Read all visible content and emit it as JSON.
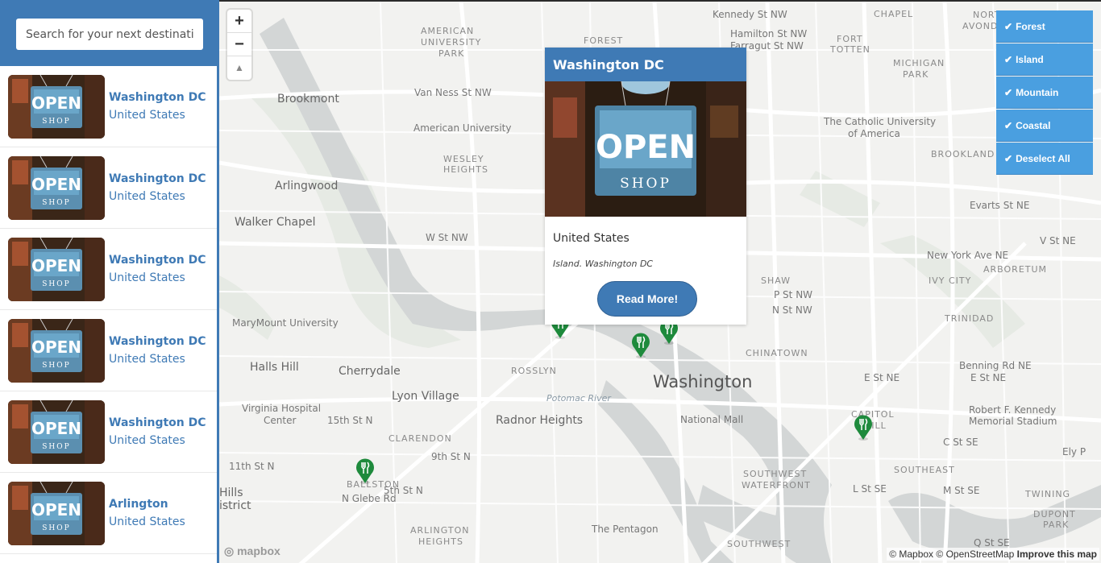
{
  "search": {
    "placeholder": "Search for your next destination!"
  },
  "listings": [
    {
      "title": "Washington DC",
      "subtitle": "United States"
    },
    {
      "title": "Washington DC",
      "subtitle": "United States"
    },
    {
      "title": "Washington DC",
      "subtitle": "United States"
    },
    {
      "title": "Washington DC",
      "subtitle": "United States"
    },
    {
      "title": "Washington DC",
      "subtitle": "United States"
    },
    {
      "title": "Arlington",
      "subtitle": "United States"
    }
  ],
  "thumbnail": {
    "sign_text": "OPEN",
    "sign_sub": "SHOP"
  },
  "zoom": {
    "in": "+",
    "out": "−",
    "compass": "▲"
  },
  "filters": [
    {
      "label": "Forest"
    },
    {
      "label": "Island"
    },
    {
      "label": "Mountain"
    },
    {
      "label": "Coastal"
    },
    {
      "label": "Deselect All"
    }
  ],
  "filter_check": "✔",
  "popup": {
    "title": "Washington DC",
    "country": "United States",
    "meta": "Island. Washington DC",
    "button": "Read More!"
  },
  "map_labels": [
    {
      "text": "Brookmont"
    },
    {
      "text": "AMERICAN"
    },
    {
      "text": "UNIVERSITY"
    },
    {
      "text": "PARK"
    },
    {
      "text": "FOREST"
    },
    {
      "text": "Kennedy St NW"
    },
    {
      "text": "Hamilton St NW"
    },
    {
      "text": "Farragut St NW"
    },
    {
      "text": "FORT"
    },
    {
      "text": "TOTTEN"
    },
    {
      "text": "MICHIGAN"
    },
    {
      "text": "PARK"
    },
    {
      "text": "NORTH"
    },
    {
      "text": "AVONDALE"
    },
    {
      "text": "CHAPEL"
    },
    {
      "text": "Van Ness St NW"
    },
    {
      "text": "American University"
    },
    {
      "text": "WESLEY"
    },
    {
      "text": "HEIGHTS"
    },
    {
      "text": "Arlingwood"
    },
    {
      "text": "Walker Chapel"
    },
    {
      "text": "The Catholic University"
    },
    {
      "text": "of America"
    },
    {
      "text": "BROOKLAND"
    },
    {
      "text": "Evarts St NE"
    },
    {
      "text": "MaryMount University"
    },
    {
      "text": "Halls Hill"
    },
    {
      "text": "Cherrydale"
    },
    {
      "text": "Lyon Village"
    },
    {
      "text": "Potomac River"
    },
    {
      "text": "ROSSLYN"
    },
    {
      "text": "Washington"
    },
    {
      "text": "CHINATOWN"
    },
    {
      "text": "National Mall"
    },
    {
      "text": "Radnor Heights"
    },
    {
      "text": "CLARENDON"
    },
    {
      "text": "Virginia Hospital"
    },
    {
      "text": "Center"
    },
    {
      "text": "BALLSTON"
    },
    {
      "text": "ARLINGTON"
    },
    {
      "text": "HEIGHTS"
    },
    {
      "text": "The Pentagon"
    },
    {
      "text": "SOUTHWEST"
    },
    {
      "text": "WATERFRONT"
    },
    {
      "text": "CAPITOL"
    },
    {
      "text": "HILL"
    },
    {
      "text": "Robert F. Kennedy"
    },
    {
      "text": "Memorial Stadium"
    },
    {
      "text": "SOUTHEAST"
    },
    {
      "text": "TWINING"
    },
    {
      "text": "DUPONT"
    },
    {
      "text": "PARK"
    },
    {
      "text": "TRINIDAD"
    },
    {
      "text": "ARBORETUM"
    },
    {
      "text": "IVY CITY"
    },
    {
      "text": "SHAW"
    },
    {
      "text": "New York Ave NE"
    },
    {
      "text": "Benning Rd NE"
    },
    {
      "text": "E St NE"
    },
    {
      "text": "E St NE"
    },
    {
      "text": "C St SE"
    },
    {
      "text": "M St SE"
    },
    {
      "text": "L St SE"
    },
    {
      "text": "V St NE"
    },
    {
      "text": "P St NW"
    },
    {
      "text": "N St NW"
    },
    {
      "text": "W St NW"
    },
    {
      "text": "9th St N"
    },
    {
      "text": "15th St N"
    },
    {
      "text": "11th St N"
    },
    {
      "text": "5th St N"
    },
    {
      "text": "N Glebe Rd"
    },
    {
      "text": "Hills"
    },
    {
      "text": "istrict"
    },
    {
      "text": "SOUTHWEST"
    },
    {
      "text": "Ely P"
    },
    {
      "text": "Q St SE"
    }
  ],
  "attribution": {
    "mapbox": "© Mapbox",
    "osm": "© OpenStreetMap",
    "improve": "Improve this map"
  },
  "mapbox_logo": "mapbox"
}
